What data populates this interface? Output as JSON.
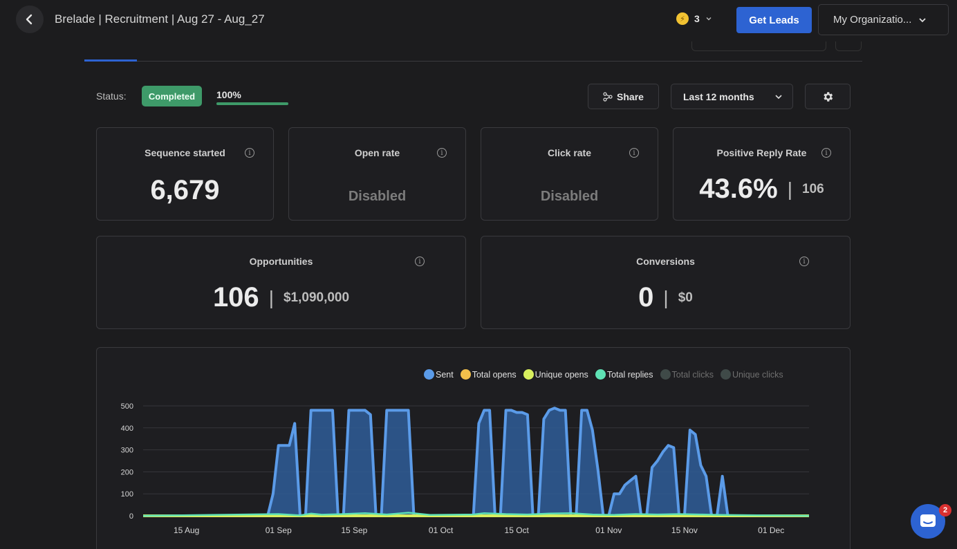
{
  "header": {
    "title": "Brelade | Recruitment | Aug 27 - Aug_27",
    "credits": "3",
    "get_leads": "Get Leads",
    "organization": "My Organizatio..."
  },
  "status": {
    "label": "Status:",
    "badge": "Completed",
    "progress_text": "100%",
    "progress_percent": 100
  },
  "toolbar": {
    "share": "Share",
    "range": "Last 12 months"
  },
  "metrics": {
    "sequence": {
      "label": "Sequence started",
      "value": "6,679"
    },
    "open_rate": {
      "label": "Open rate",
      "value": "Disabled"
    },
    "click_rate": {
      "label": "Click rate",
      "value": "Disabled"
    },
    "reply_rate": {
      "label": "Positive Reply Rate",
      "value": "43.6%",
      "count": "106"
    },
    "opportunities": {
      "label": "Opportunities",
      "value": "106",
      "amount": "$1,090,000"
    },
    "conversions": {
      "label": "Conversions",
      "value": "0",
      "amount": "$0"
    }
  },
  "legend": [
    {
      "label": "Sent",
      "color": "#5b9be8",
      "active": true
    },
    {
      "label": "Total opens",
      "color": "#f2c04b",
      "active": true
    },
    {
      "label": "Unique opens",
      "color": "#d8ef5e",
      "active": true
    },
    {
      "label": "Total replies",
      "color": "#5fe2b5",
      "active": true
    },
    {
      "label": "Total clicks",
      "color": "#3f4a48",
      "active": false
    },
    {
      "label": "Unique clicks",
      "color": "#3f4a48",
      "active": false
    }
  ],
  "chat": {
    "badge": "2"
  },
  "chart_data": {
    "type": "area",
    "y_ticks": [
      "0",
      "100",
      "200",
      "300",
      "400",
      "500"
    ],
    "x_ticks": [
      "15 Aug",
      "01 Sep",
      "15 Sep",
      "01 Oct",
      "15 Oct",
      "01 Nov",
      "15 Nov",
      "01 Dec"
    ],
    "ylim": [
      0,
      500
    ],
    "grid": true,
    "legend_position": "top-right",
    "series": [
      {
        "name": "Sent",
        "color": "#5b9be8",
        "points": [
          [
            7,
            0
          ],
          [
            30,
            0
          ],
          [
            31,
            100
          ],
          [
            32,
            320
          ],
          [
            33,
            320
          ],
          [
            34,
            320
          ],
          [
            35,
            420
          ],
          [
            36,
            0
          ],
          [
            37,
            0
          ],
          [
            38,
            480
          ],
          [
            39,
            480
          ],
          [
            40,
            480
          ],
          [
            41,
            480
          ],
          [
            42,
            480
          ],
          [
            43,
            0
          ],
          [
            44,
            0
          ],
          [
            45,
            480
          ],
          [
            46,
            480
          ],
          [
            47,
            480
          ],
          [
            48,
            480
          ],
          [
            49,
            460
          ],
          [
            50,
            0
          ],
          [
            51,
            0
          ],
          [
            52,
            480
          ],
          [
            53,
            480
          ],
          [
            54,
            480
          ],
          [
            55,
            480
          ],
          [
            56,
            480
          ],
          [
            57,
            0
          ],
          [
            68,
            0
          ],
          [
            69,
            420
          ],
          [
            70,
            480
          ],
          [
            71,
            480
          ],
          [
            72,
            0
          ],
          [
            73,
            0
          ],
          [
            74,
            480
          ],
          [
            75,
            480
          ],
          [
            76,
            470
          ],
          [
            77,
            470
          ],
          [
            78,
            460
          ],
          [
            79,
            0
          ],
          [
            80,
            0
          ],
          [
            81,
            440
          ],
          [
            82,
            480
          ],
          [
            83,
            490
          ],
          [
            84,
            480
          ],
          [
            85,
            480
          ],
          [
            86,
            0
          ],
          [
            87,
            0
          ],
          [
            88,
            480
          ],
          [
            89,
            480
          ],
          [
            90,
            390
          ],
          [
            91,
            210
          ],
          [
            92,
            0
          ],
          [
            93,
            0
          ],
          [
            94,
            100
          ],
          [
            95,
            100
          ],
          [
            96,
            140
          ],
          [
            97,
            160
          ],
          [
            98,
            180
          ],
          [
            99,
            0
          ],
          [
            100,
            0
          ],
          [
            101,
            220
          ],
          [
            102,
            250
          ],
          [
            103,
            290
          ],
          [
            104,
            320
          ],
          [
            105,
            310
          ],
          [
            106,
            0
          ],
          [
            107,
            0
          ],
          [
            108,
            390
          ],
          [
            109,
            370
          ],
          [
            110,
            230
          ],
          [
            111,
            180
          ],
          [
            112,
            0
          ],
          [
            113,
            0
          ],
          [
            114,
            180
          ],
          [
            115,
            0
          ],
          [
            130,
            0
          ]
        ]
      },
      {
        "name": "Total opens",
        "color": "#f2c04b",
        "points": [
          [
            7,
            0
          ],
          [
            130,
            0
          ]
        ]
      },
      {
        "name": "Unique opens",
        "color": "#d8ef5e",
        "points": [
          [
            7,
            0
          ],
          [
            130,
            0
          ]
        ]
      },
      {
        "name": "Total replies",
        "color": "#5fe2b5",
        "points": [
          [
            7,
            0
          ],
          [
            32,
            8
          ],
          [
            36,
            2
          ],
          [
            38,
            10
          ],
          [
            40,
            5
          ],
          [
            44,
            8
          ],
          [
            48,
            12
          ],
          [
            52,
            6
          ],
          [
            56,
            14
          ],
          [
            60,
            4
          ],
          [
            68,
            6
          ],
          [
            70,
            12
          ],
          [
            74,
            8
          ],
          [
            78,
            6
          ],
          [
            82,
            10
          ],
          [
            86,
            12
          ],
          [
            90,
            6
          ],
          [
            94,
            4
          ],
          [
            98,
            8
          ],
          [
            102,
            6
          ],
          [
            106,
            8
          ],
          [
            110,
            6
          ],
          [
            114,
            4
          ],
          [
            130,
            0
          ]
        ]
      }
    ],
    "x_tick_days": [
      15,
      32,
      46,
      62,
      76,
      93,
      107,
      123
    ]
  }
}
